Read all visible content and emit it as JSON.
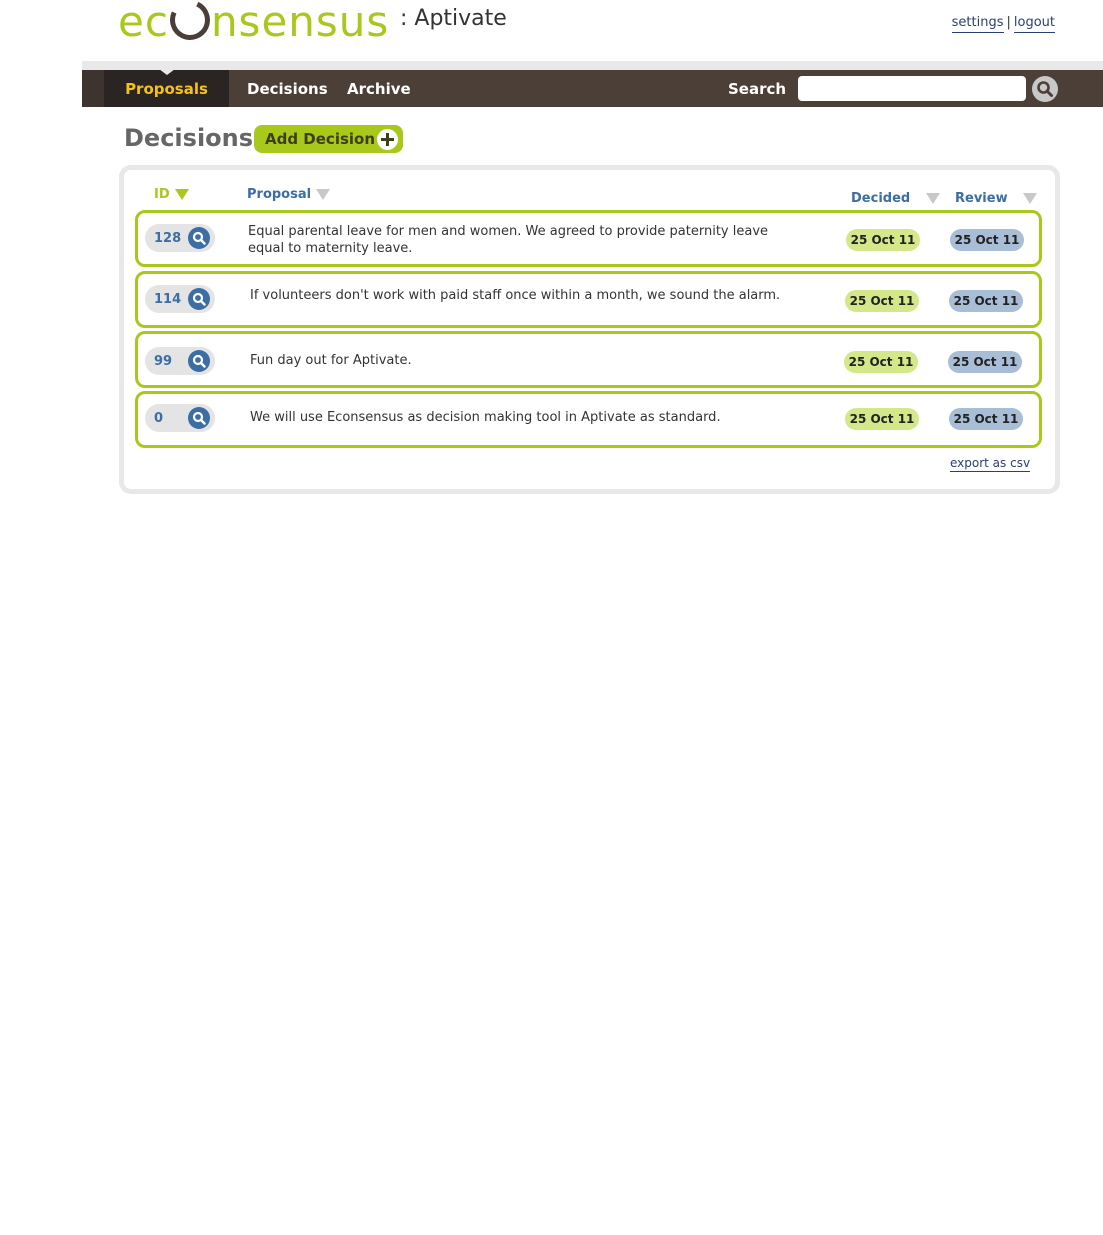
{
  "brand": {
    "logo_ec": "ec",
    "logo_rest": "nsensus",
    "org": ": Aptivate"
  },
  "user_links": {
    "settings": "settings",
    "separator": "|",
    "logout": "logout"
  },
  "nav": {
    "tabs": [
      {
        "label": "Proposals",
        "active": true
      },
      {
        "label": "Decisions",
        "active": false
      },
      {
        "label": "Archive",
        "active": false
      }
    ],
    "search_label": "Search",
    "search_value": ""
  },
  "page": {
    "title": "Decisions",
    "add_button": "Add Decision"
  },
  "table": {
    "columns": {
      "id": "ID",
      "proposal": "Proposal",
      "decided": "Decided",
      "review": "Review"
    },
    "rows": [
      {
        "id": "128",
        "proposal": "Equal parental leave for men and women. We agreed to provide paternity leave equal to maternity leave.",
        "decided": "25 Oct 11",
        "review": "25 Oct 11"
      },
      {
        "id": "114",
        "proposal": "If volunteers don't work with paid staff once within a month, we sound the alarm.",
        "decided": "25 Oct 11",
        "review": "25 Oct 11"
      },
      {
        "id": "99",
        "proposal": "Fun day out for Aptivate.",
        "decided": "25 Oct 11",
        "review": "25 Oct 11"
      },
      {
        "id": "0",
        "proposal": "We will use Econsensus as decision making tool in Aptivate as standard.",
        "decided": "25 Oct 11",
        "review": "25 Oct 11"
      }
    ],
    "export_link": "export as csv"
  },
  "colors": {
    "brand_green": "#a8c81c",
    "nav_brown": "#4c3f38",
    "active_tab_text": "#f4c21b",
    "link_blue": "#3a6ea5"
  },
  "icons": {
    "search": "magnifier-icon",
    "add": "plus-circle-icon",
    "sort": "triangle-down-icon",
    "view": "magnifier-icon"
  }
}
